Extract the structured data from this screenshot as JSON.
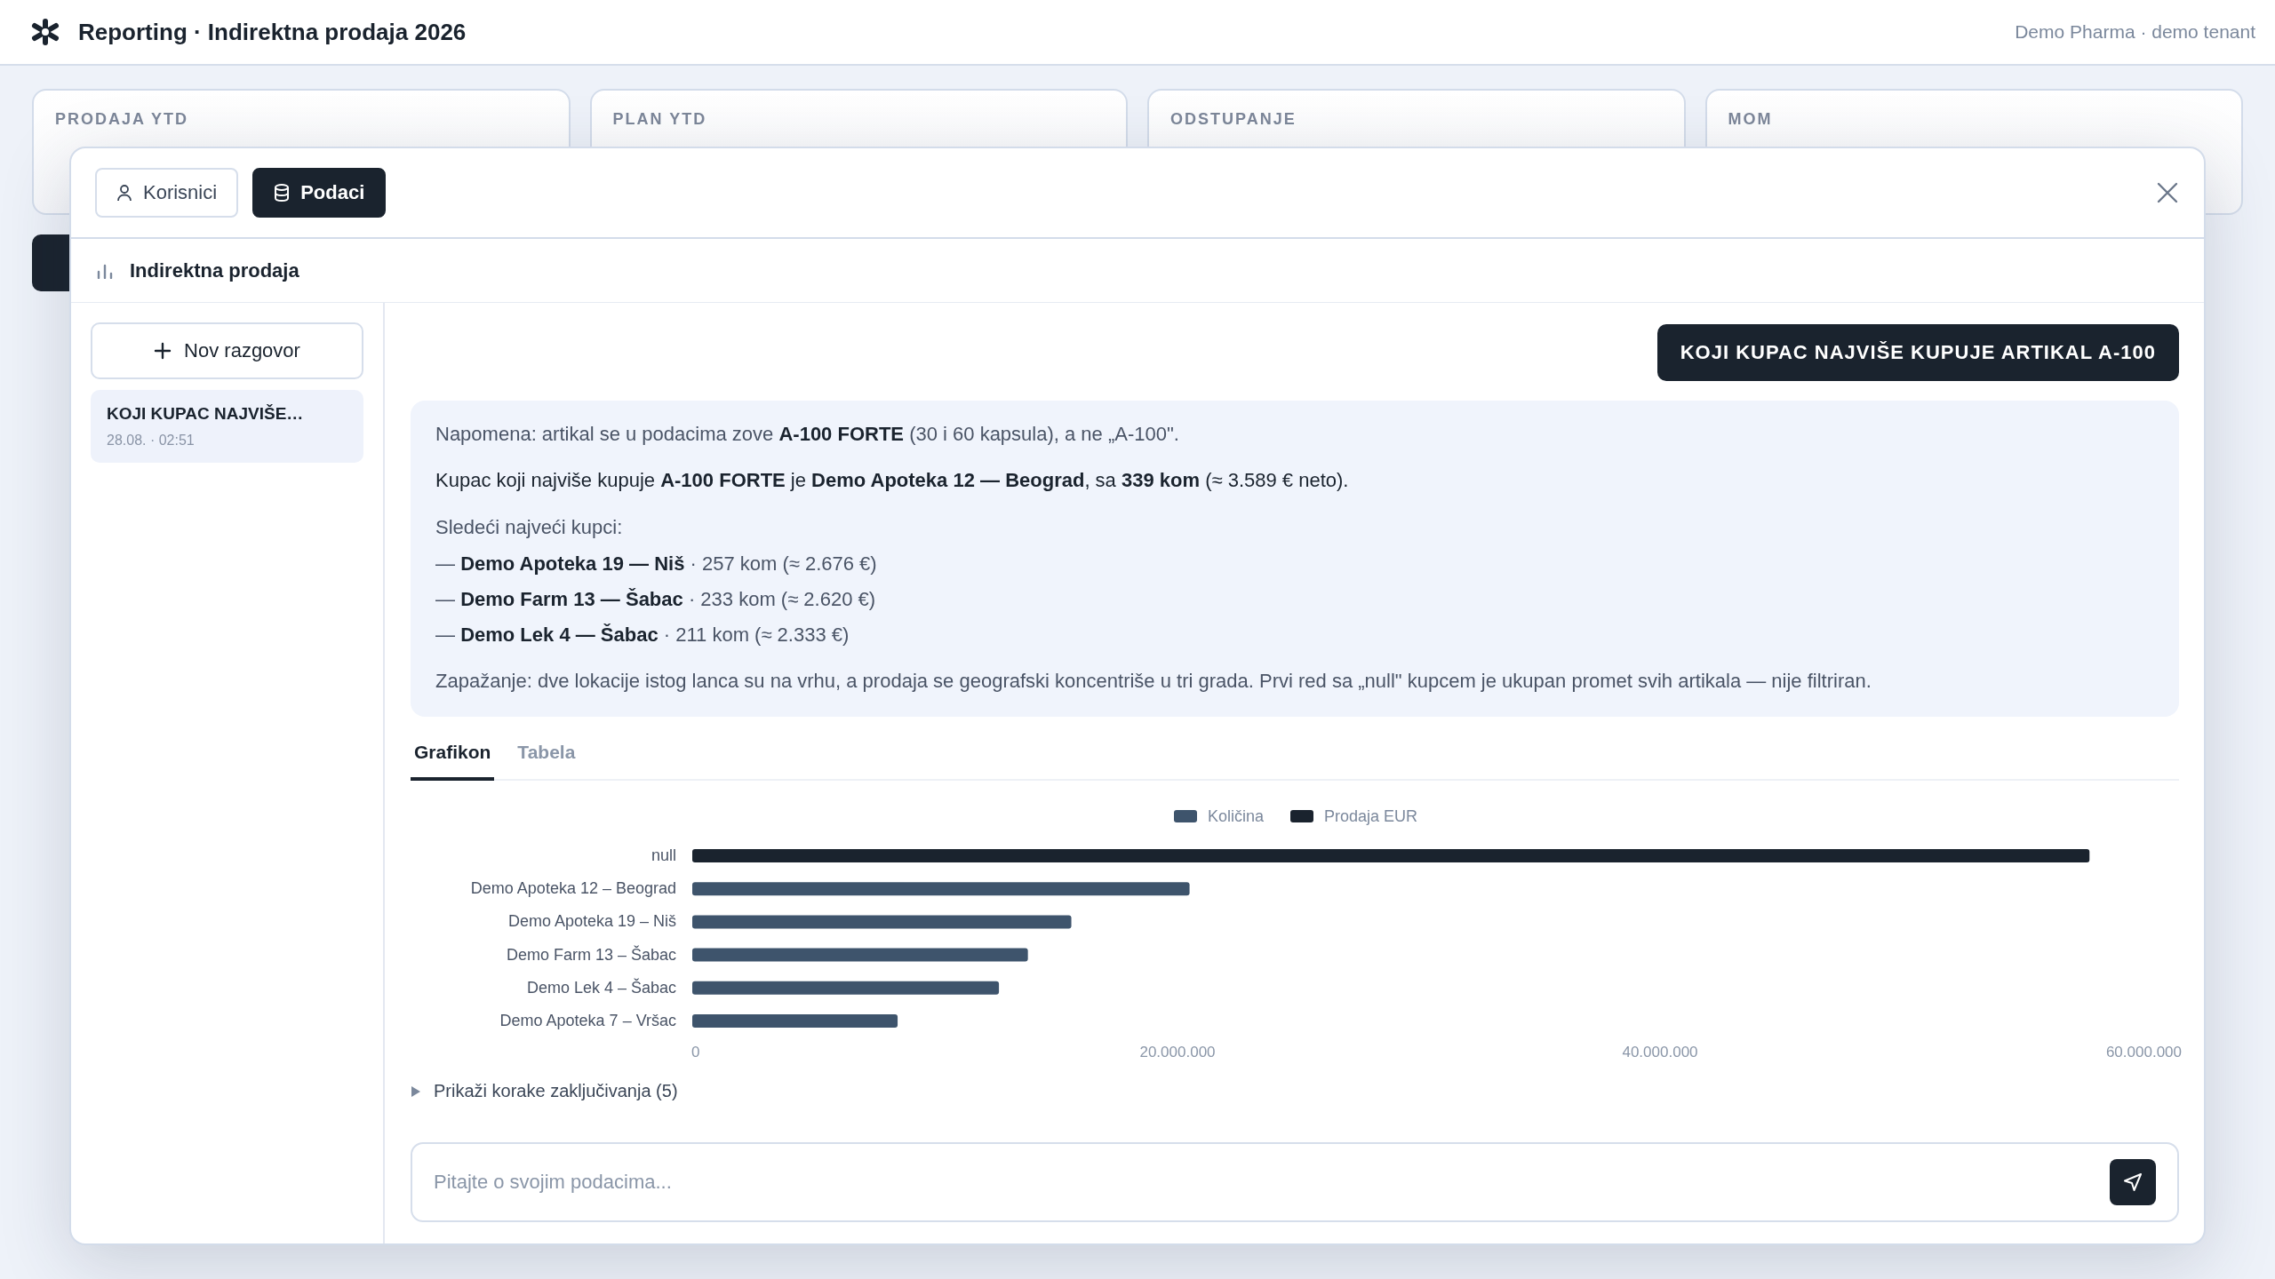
{
  "header": {
    "title": "Reporting · Indirektna prodaja 2026",
    "tenant": "Demo Pharma · demo tenant"
  },
  "kpi_cards": [
    {
      "label": "PRODAJA YTD"
    },
    {
      "label": "PLAN YTD"
    },
    {
      "label": "ODSTUPANJE"
    },
    {
      "label": "MOM"
    }
  ],
  "modal": {
    "tabs": [
      {
        "label": "Korisnici",
        "kind": "users",
        "selected": false
      },
      {
        "label": "Podaci",
        "kind": "data",
        "selected": true
      }
    ],
    "section_title": "Indirektna prodaja",
    "new_chat_button": "Nov razgovor",
    "conversations": [
      {
        "title": "KOJI KUPAC NAJVIŠE…",
        "time": "28.08. · 02:51",
        "selected": true
      }
    ],
    "question": "KOJI KUPAC NAJVIŠE KUPUJE ARTIKAL A-100",
    "answer": [
      {
        "kind": "note",
        "text": "Napomena: artikal se u podacima zove **A-100 FORTE** (30 i 60 kapsula), a ne „A-100\"."
      },
      {
        "kind": "paragraph",
        "text": "Kupac koji najviše kupuje **A-100 FORTE** je **Demo Apoteka 12 — Beograd**, sa **339 kom** (≈ 3.589 € neto)."
      },
      {
        "kind": "list",
        "title": "Sledeći najveći kupci:",
        "items": [
          "— **Demo Apoteka 19 — Niš** · 257 kom (≈ 2.676 €)",
          "— **Demo Farm 13 — Šabac** · 233 kom (≈ 2.620 €)",
          "— **Demo Lek 4 — Šabac** · 211 kom (≈ 2.333 €)"
        ]
      },
      {
        "kind": "note",
        "text": "Zapažanje: dve lokacije istog lanca su na vrhu, a prodaja se geografski koncentriše u tri grada. Prvi red sa „null\" kupcem je ukupan promet svih artikala — nije filtriran."
      }
    ],
    "result_tabs": [
      {
        "label": "Grafikon",
        "selected": true
      },
      {
        "label": "Tabela",
        "selected": false
      }
    ],
    "chart_data": {
      "type": "bar",
      "orientation": "horizontal",
      "stacked": true,
      "legend": "top",
      "categories": [
        "null",
        "Demo Apoteka 12 – Beograd",
        "Demo Apoteka 19 – Niš",
        "Demo Farm 13 – Šabac",
        "Demo Lek 4 – Šabac",
        "Demo Apoteka 7 – Vršac"
      ],
      "series": [
        {
          "name": "Količina",
          "color": "#3e546c",
          "values": [
            null,
            20500000,
            15600000,
            13800000,
            12600000,
            8400000
          ]
        },
        {
          "name": "Prodaja EUR",
          "color": "#1a232e",
          "values": [
            57800000,
            null,
            null,
            null,
            null,
            null
          ]
        }
      ],
      "xlim": [
        0,
        60000000
      ],
      "xticks": [
        {
          "value": 0,
          "label": "0"
        },
        {
          "value": 20000000,
          "label": "20.000.000"
        },
        {
          "value": 40000000,
          "label": "40.000.000"
        },
        {
          "value": 60000000,
          "label": "60.000.000"
        }
      ]
    },
    "reasoning_toggle": {
      "label": "Prikaži korake zaključivanja (5)",
      "expanded": false
    },
    "input": {
      "placeholder": "Pitajte o svojim podacima..."
    }
  }
}
